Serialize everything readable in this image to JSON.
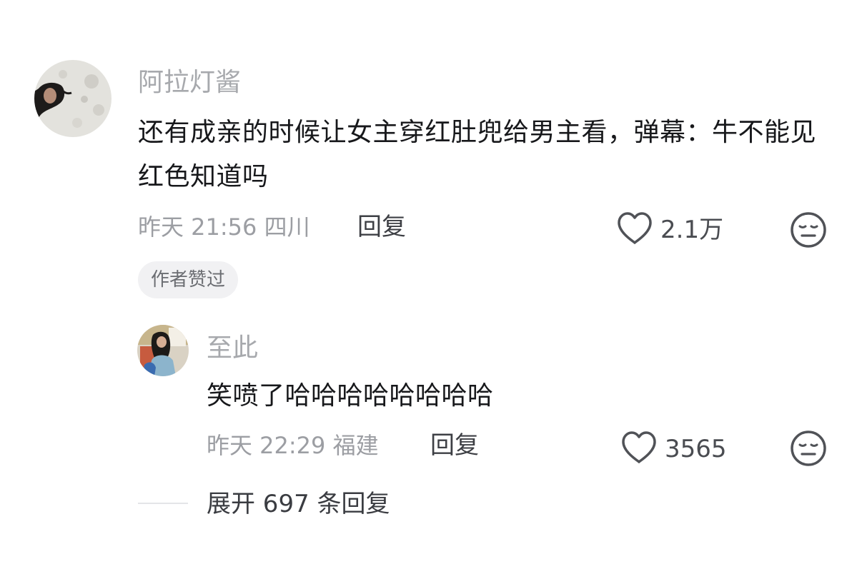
{
  "comment": {
    "username": "阿拉灯酱",
    "text": "还有成亲的时候让女主穿红肚兜给男主看，弹幕：牛不能见红色知道吗",
    "meta": "昨天 21:56 四川",
    "reply_label": "回复",
    "like_count": "2.1万",
    "badge": "作者赞过",
    "avatar_icon": "avatar-photo",
    "like_icon": "heart-outline-icon",
    "dislike_icon": "meh-face-icon"
  },
  "reply": {
    "username": "至此",
    "text": "笑喷了哈哈哈哈哈哈哈哈",
    "meta": "昨天 22:29 福建",
    "reply_label": "回复",
    "like_count": "3565",
    "avatar_icon": "avatar-photo",
    "like_icon": "heart-outline-icon",
    "dislike_icon": "meh-face-icon"
  },
  "expand": {
    "label": "展开 697 条回复"
  },
  "colors": {
    "username": "#a7a9ad",
    "content": "#17181b",
    "meta": "#9c9ea3",
    "badge_bg": "#f1f1f3"
  }
}
